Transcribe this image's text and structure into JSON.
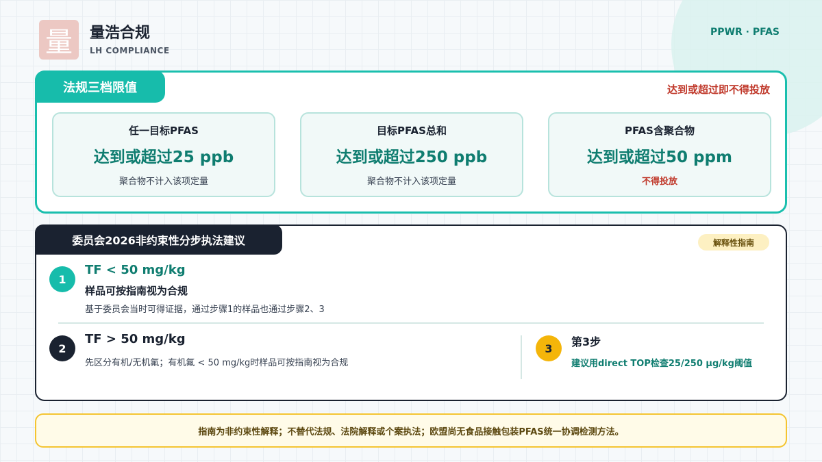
{
  "brand": {
    "logo_char": "量",
    "name": "量浩合规",
    "subtitle": "LH COMPLIANCE",
    "tagline": "PPWR · PFAS"
  },
  "limits_panel": {
    "tab_label": "法规三档限值",
    "warning": "达到或超过即不得投放",
    "cards": [
      {
        "title": "任一目标PFAS",
        "value": "达到或超过25 ppb",
        "note": "聚合物不计入该项定量"
      },
      {
        "title": "目标PFAS总和",
        "value": "达到或超过250 ppb",
        "note": "聚合物不计入该项定量"
      },
      {
        "title": "PFAS含聚合物",
        "value": "达到或超过50 ppm",
        "note": "不得投放"
      }
    ]
  },
  "steps_panel": {
    "tab_label": "委员会2026非约束性分步执法建议",
    "badge": "解释性指南",
    "steps": [
      {
        "num": "1",
        "condition": "TF < 50 mg/kg",
        "title": "样品可按指南视为合规",
        "desc": "基于委员会当时可得证据，通过步骤1的样品也通过步骤2、3"
      },
      {
        "num": "2",
        "condition": "TF > 50 mg/kg",
        "desc": "先区分有机/无机氟；有机氟 < 50 mg/kg时样品可按指南视为合规"
      },
      {
        "num": "3",
        "title": "第3步",
        "desc": "建议用direct TOP检查25/250 μg/kg阈值"
      }
    ]
  },
  "footnote": "指南为非约束性解释；不替代法规、法院解释或个案执法；欧盟尚无食品接触包装PFAS统一协调检测方法。",
  "colors": {
    "teal": "#17bcab",
    "teal_text": "#0f7d70",
    "dark": "#1a2230",
    "warning_red": "#c0392b",
    "yellow": "#f4b50a"
  }
}
